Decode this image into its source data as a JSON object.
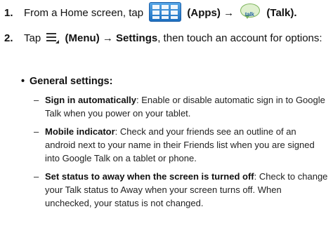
{
  "top_fragment": "",
  "steps": [
    {
      "number": "1.",
      "pre": "From a Home screen, tap",
      "apps_label": "(Apps)",
      "arrow": "→",
      "talk_icon_text": "talk",
      "talk_label": "(Talk)."
    },
    {
      "number": "2.",
      "pre": "Tap",
      "menu_label": "(Menu)",
      "arrow": "→",
      "settings": "Settings",
      "post": ", then touch an account for options:"
    }
  ],
  "general": {
    "bullet": "•",
    "heading": "General settings",
    "colon": ":"
  },
  "items": [
    {
      "dash": "–",
      "title": "Sign in automatically",
      "text": ": Enable or disable automatic sign in to Google Talk when you power on your tablet."
    },
    {
      "dash": "–",
      "title": "Mobile indicator",
      "text": ": Check and your friends see an outline of an android next to your name in their Friends list when you are signed into Google Talk on a tablet or phone."
    },
    {
      "dash": "–",
      "title": "Set status to away when the screen is turned off",
      "text": ": Check to change your Talk status to Away when your screen turns off. When unchecked, your status is not changed."
    }
  ],
  "icons": {
    "apps": "apps-grid-icon",
    "talk": "talk-icon",
    "menu": "menu-icon"
  }
}
